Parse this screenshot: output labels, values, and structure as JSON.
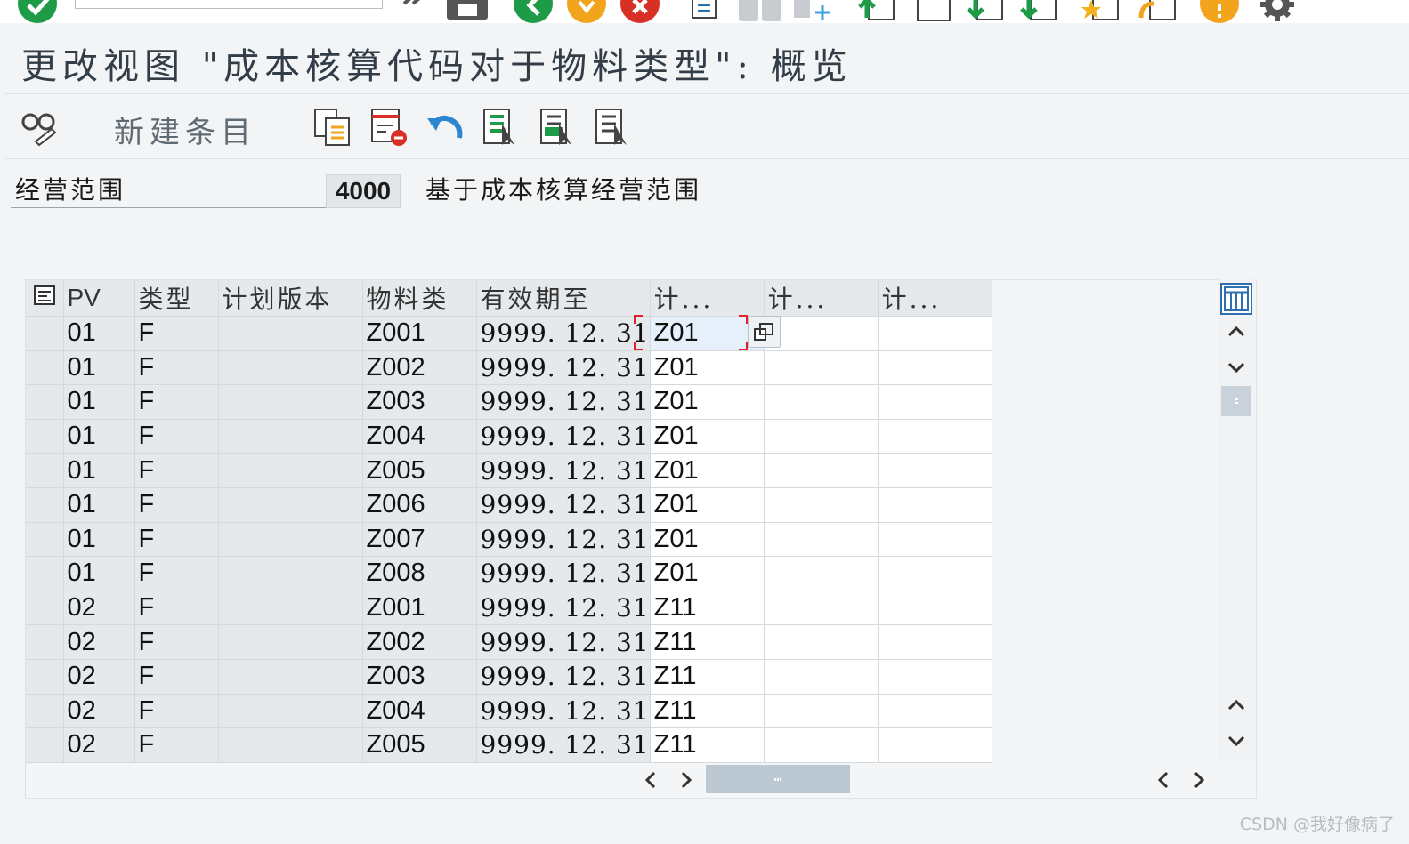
{
  "window": {
    "title": "更改视图 \"成本核算代码对于物料类型\": 概览"
  },
  "toolbar": {
    "new_entries_label": "新建条目"
  },
  "header": {
    "field_label": "经营范围",
    "field_value": "4000",
    "field_description": "基于成本核算经营范围"
  },
  "table": {
    "columns": [
      "PV",
      "类型",
      "计划版本",
      "物料类",
      "有效期至",
      "计...",
      "计...",
      "计..."
    ],
    "rows": [
      [
        "01",
        "F",
        "",
        "Z001",
        "9999. 12. 31",
        "Z01",
        "",
        ""
      ],
      [
        "01",
        "F",
        "",
        "Z002",
        "9999. 12. 31",
        "Z01",
        "",
        ""
      ],
      [
        "01",
        "F",
        "",
        "Z003",
        "9999. 12. 31",
        "Z01",
        "",
        ""
      ],
      [
        "01",
        "F",
        "",
        "Z004",
        "9999. 12. 31",
        "Z01",
        "",
        ""
      ],
      [
        "01",
        "F",
        "",
        "Z005",
        "9999. 12. 31",
        "Z01",
        "",
        ""
      ],
      [
        "01",
        "F",
        "",
        "Z006",
        "9999. 12. 31",
        "Z01",
        "",
        ""
      ],
      [
        "01",
        "F",
        "",
        "Z007",
        "9999. 12. 31",
        "Z01",
        "",
        ""
      ],
      [
        "01",
        "F",
        "",
        "Z008",
        "9999. 12. 31",
        "Z01",
        "",
        ""
      ],
      [
        "02",
        "F",
        "",
        "Z001",
        "9999. 12. 31",
        "Z11",
        "",
        ""
      ],
      [
        "02",
        "F",
        "",
        "Z002",
        "9999. 12. 31",
        "Z11",
        "",
        ""
      ],
      [
        "02",
        "F",
        "",
        "Z003",
        "9999. 12. 31",
        "Z11",
        "",
        ""
      ],
      [
        "02",
        "F",
        "",
        "Z004",
        "9999. 12. 31",
        "Z11",
        "",
        ""
      ],
      [
        "02",
        "F",
        "",
        "Z005",
        "9999. 12. 31",
        "Z11",
        "",
        ""
      ]
    ]
  },
  "colors": {
    "background": "#f2f4f5",
    "key_column": "#e6e9eb",
    "focus_frame": "#e0202a",
    "accent_blue": "#2d6fb0",
    "ok_green": "#1e9b47",
    "warn_orange": "#f2a41c",
    "cancel_red": "#d93025"
  },
  "icons": {
    "system_toolbar": [
      "enter-icon",
      "save-icon",
      "back-icon",
      "exit-icon",
      "cancel-icon",
      "print-icon",
      "find-icon",
      "find-next-icon",
      "first-page-icon",
      "previous-page-icon",
      "next-page-icon",
      "last-page-icon",
      "create-session-icon",
      "shortcut-icon",
      "help-icon",
      "settings-icon"
    ],
    "app_toolbar": [
      "display-change-icon",
      "copy-as-icon",
      "delete-icon",
      "undo-change-icon",
      "select-all-icon",
      "select-block-icon",
      "deselect-all-icon"
    ]
  },
  "watermark": "CSDN @我好像病了"
}
